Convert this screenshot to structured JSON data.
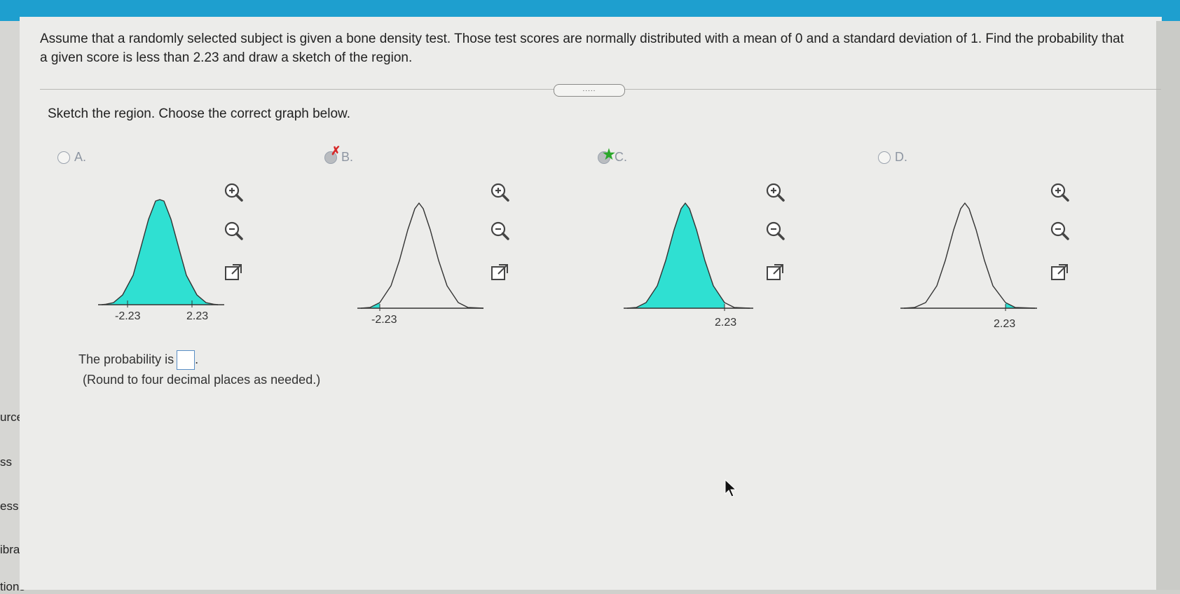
{
  "sidebar": {
    "items": [
      "urces",
      "ss",
      "ess",
      "ibrary",
      "tions"
    ]
  },
  "question": {
    "text": "Assume that a randomly selected subject is given a bone density test. Those test scores are normally distributed with a mean of 0 and a standard deviation of 1. Find the probability that a given score is less than 2.23 and draw a sketch of the region.",
    "expander": "....."
  },
  "instruction": "Sketch the region. Choose the correct graph below.",
  "options": [
    {
      "label": "A.",
      "ticks": [
        "-2.23",
        "2.23"
      ],
      "shaded": "between",
      "state": "none"
    },
    {
      "label": "B.",
      "ticks": [
        "-2.23"
      ],
      "shaded": "left-tail",
      "state": "wrong"
    },
    {
      "label": "C.",
      "ticks": [
        "2.23"
      ],
      "shaded": "left-of-2.23",
      "state": "correct"
    },
    {
      "label": "D.",
      "ticks": [
        "2.23"
      ],
      "shaded": "right-tail",
      "state": "none"
    }
  ],
  "icons": [
    "zoom-in-icon",
    "zoom-out-icon",
    "popout-icon"
  ],
  "colors": {
    "shade": "#2fe0d2",
    "accent": "#1e9fcf",
    "wrong": "#d62828",
    "correct": "#2aa72a"
  },
  "answer": {
    "prompt": "The probability is",
    "value": "",
    "hint": "(Round to four decimal places as needed.)"
  }
}
